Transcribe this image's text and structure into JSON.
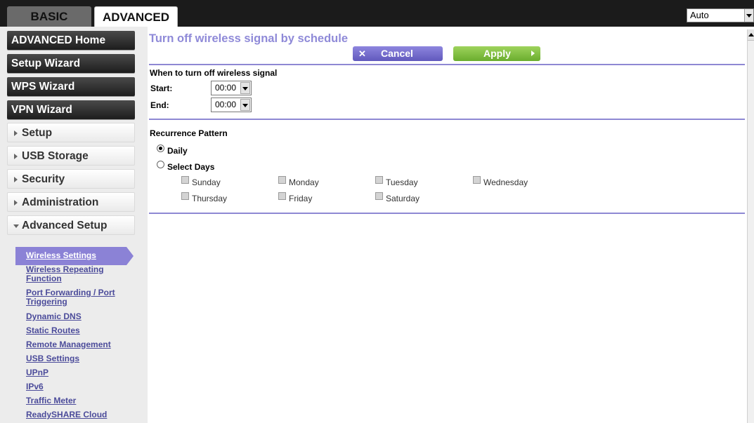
{
  "tabs": {
    "basic": "BASIC",
    "advanced": "ADVANCED"
  },
  "language": {
    "selected": "Auto"
  },
  "sidebar": {
    "main_buttons": [
      "ADVANCED Home",
      "Setup Wizard",
      "WPS Wizard",
      "VPN Wizard"
    ],
    "sections": [
      "Setup",
      "USB Storage",
      "Security",
      "Administration",
      "Advanced Setup"
    ],
    "sublinks": [
      "Wireless Settings",
      "Wireless Repeating Function",
      "Port Forwarding / Port Triggering",
      "Dynamic DNS",
      "Static Routes",
      "Remote Management",
      "USB Settings",
      "UPnP",
      "IPv6",
      "Traffic Meter",
      "ReadySHARE Cloud"
    ]
  },
  "main": {
    "title": "Turn off wireless signal by schedule",
    "cancel_label": "Cancel",
    "apply_label": "Apply",
    "when_label": "When to turn off wireless signal",
    "start_label": "Start:",
    "start_value": "00:00",
    "end_label": "End:",
    "end_value": "00:00",
    "recurrence_label": "Recurrence Pattern",
    "daily_label": "Daily",
    "select_days_label": "Select Days",
    "selected_pattern": "Daily",
    "days": [
      "Sunday",
      "Monday",
      "Tuesday",
      "Wednesday",
      "Thursday",
      "Friday",
      "Saturday"
    ]
  },
  "colors": {
    "accent": "#8e88d3",
    "apply": "#79b73a",
    "cancel": "#6b63c7"
  }
}
